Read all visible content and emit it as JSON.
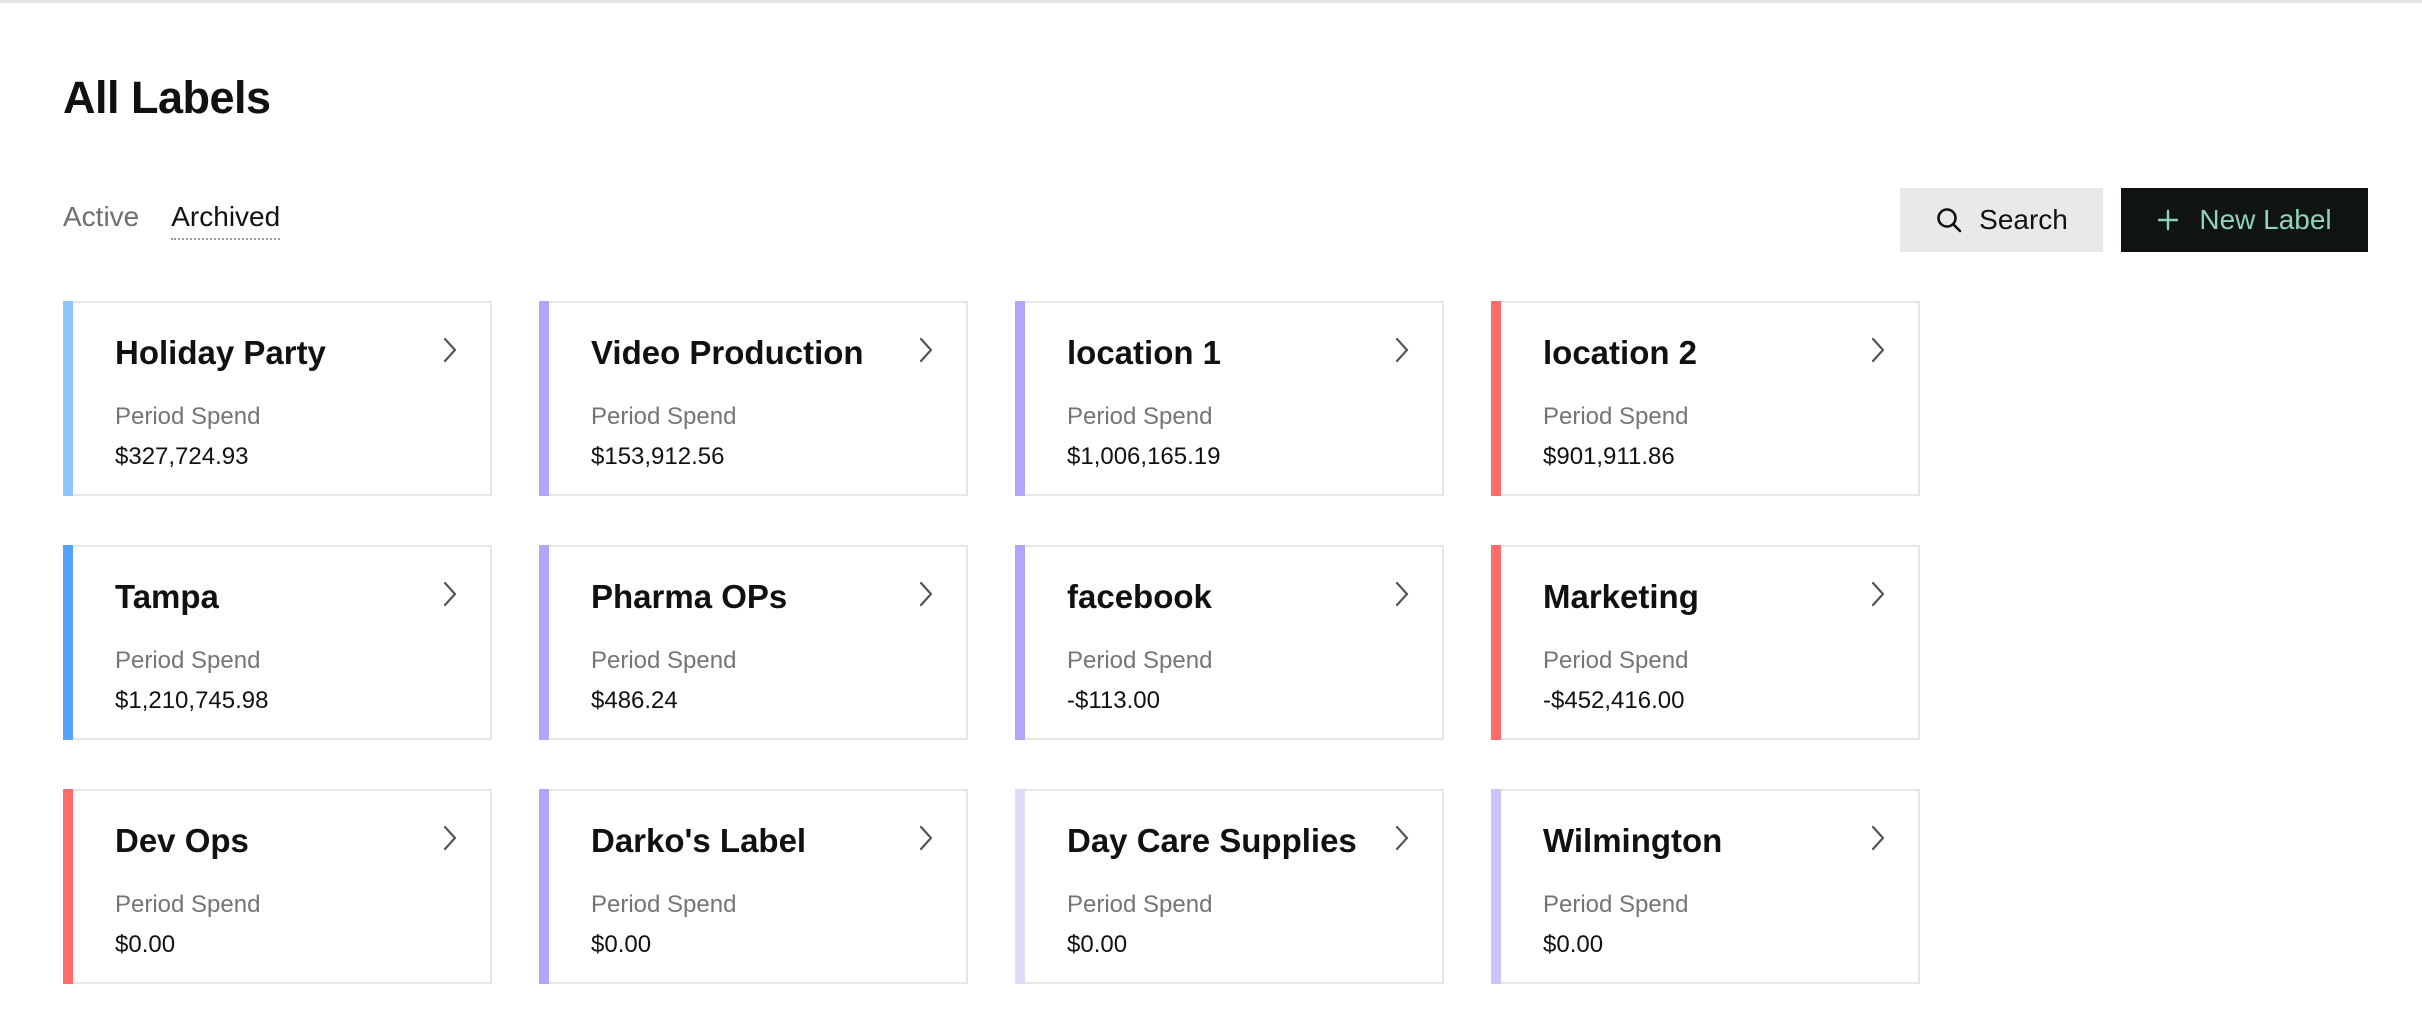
{
  "page": {
    "title": "All Labels"
  },
  "tabs": [
    {
      "label": "Active",
      "active": false
    },
    {
      "label": "Archived",
      "active": true
    }
  ],
  "toolbar": {
    "search_label": "Search",
    "search_icon": "search-icon",
    "new_label": "New Label",
    "new_icon": "plus-icon"
  },
  "colors": {
    "new_label_bg": "#0f1311",
    "new_label_text": "#8fd3bf",
    "search_bg": "#e9e9ea"
  },
  "labels": [
    {
      "name": "Holiday Party",
      "meta": "Period Spend",
      "amount": "$327,724.93",
      "color": "#8ec5ff"
    },
    {
      "name": "Video Production",
      "meta": "Period Spend",
      "amount": "$153,912.56",
      "color": "#b4a4fb"
    },
    {
      "name": "location 1",
      "meta": "Period Spend",
      "amount": "$1,006,165.19",
      "color": "#b4a4fb"
    },
    {
      "name": "location 2",
      "meta": "Period Spend",
      "amount": "$901,911.86",
      "color": "#ff6b6b"
    },
    {
      "name": "Tampa",
      "meta": "Period Spend",
      "amount": "$1,210,745.98",
      "color": "#55a2ff"
    },
    {
      "name": "Pharma OPs",
      "meta": "Period Spend",
      "amount": "$486.24",
      "color": "#b4a4fb"
    },
    {
      "name": "facebook",
      "meta": "Period Spend",
      "amount": "-$113.00",
      "color": "#b4a4fb"
    },
    {
      "name": "Marketing",
      "meta": "Period Spend",
      "amount": "-$452,416.00",
      "color": "#ff6b6b"
    },
    {
      "name": "Dev Ops",
      "meta": "Period Spend",
      "amount": "$0.00",
      "color": "#ff6b6b"
    },
    {
      "name": "Darko's Label",
      "meta": "Period Spend",
      "amount": "$0.00",
      "color": "#b4a4fb"
    },
    {
      "name": "Day Care Supplies",
      "meta": "Period Spend",
      "amount": "$0.00",
      "color": "#dedbf6"
    },
    {
      "name": "Wilmington",
      "meta": "Period Spend",
      "amount": "$0.00",
      "color": "#cbc3fb"
    }
  ],
  "card_icon": "chevron-right-icon"
}
